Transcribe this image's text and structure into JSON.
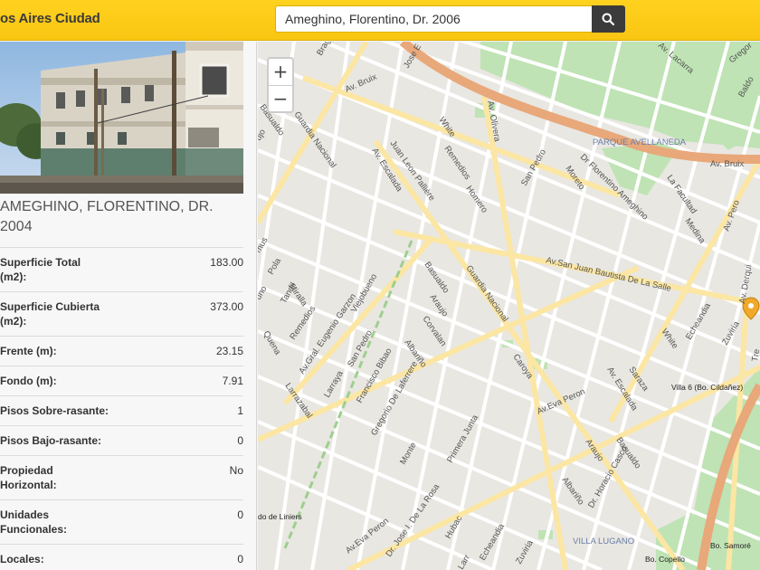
{
  "header": {
    "brand": "os Aires Ciudad",
    "search_value": "Ameghino, Florentino, Dr. 2006"
  },
  "sidebar": {
    "address_line1": "AMEGHINO, FLORENTINO, DR.",
    "address_line2": "2004",
    "attributes": [
      {
        "label": [
          "Superficie Total",
          "(m2):"
        ],
        "value": "183.00"
      },
      {
        "label": [
          "Superficie Cubierta",
          "(m2):"
        ],
        "value": "373.00"
      },
      {
        "label": [
          "Frente (m):"
        ],
        "value": "23.15"
      },
      {
        "label": [
          "Fondo (m):"
        ],
        "value": "7.91"
      },
      {
        "label": [
          "Pisos Sobre-rasante:"
        ],
        "value": "1"
      },
      {
        "label": [
          "Pisos Bajo-rasante:"
        ],
        "value": "0"
      },
      {
        "label": [
          "Propiedad",
          "Horizontal:"
        ],
        "value": "No"
      },
      {
        "label": [
          "Unidades",
          "Funcionales:"
        ],
        "value": "0"
      },
      {
        "label": [
          "Locales:"
        ],
        "value": "0"
      }
    ]
  },
  "map": {
    "zoom_in": "+",
    "zoom_out": "−",
    "labels": {
      "bruix": "Av. Bruix",
      "bruix2": "Av. Bruix",
      "lacarra": "Av. Lacarra",
      "olivera": "Av. Olivera",
      "escalada": "Av. Escalada",
      "escalada2": "Av. Escalada",
      "san_juan": "Av.San Juan Bautista De La Salle",
      "eva_peron": "Av.Eva Peron",
      "eva_peron2": "Av.Eva Peron",
      "garzon": "Av.Gral. Eugenio Garzon",
      "parque": "PARQUE AVELLANEDA",
      "lugano": "VILLA LUGANO",
      "villa6": "Villa 6 (Bo. Cildañez)",
      "copello": "Bo. Copello",
      "samore": "Bo. Samoré",
      "liniers": "do de Liniers",
      "guardia": "Guardia Nacional",
      "guardia2": "Guardia Nacional",
      "pallerie": "Juan Leon Pallière",
      "remedios": "Remedios",
      "remedios2": "Remedios",
      "white": "White",
      "white2": "White",
      "homero": "Homero",
      "san_pedro": "San Pedro",
      "san_pedro2": "San Pedro",
      "moreto": "Moreto",
      "ameghino": "Dr Florentino Ameghino",
      "facultad": "La Facultad",
      "medina": "Medina",
      "basualdo": "Basualdo",
      "basualdo2": "Basualdo",
      "basualdo3": "Basualdo",
      "araujo": "Araujo",
      "araujo2": "Araujo",
      "corvalan": "Corvalan",
      "albarino": "Albariño",
      "albarino2": "Albariño",
      "caroya": "Caroya",
      "miralla": "Miralla",
      "viejobueno": "Viejobueno",
      "tandil": "Tandil",
      "pola": "Pola",
      "larraya": "Larraya",
      "larrazabal": "Larrazabal",
      "bilbao": "Francisco Bibao",
      "laferrere": "Gregorio De Laferrere",
      "monte": "Monte",
      "primera_junta": "Primera Junta",
      "de_la_rosa": "Dr. Jose I. De La Rosa",
      "hubac": "Hubac",
      "echeandia": "Echeandia",
      "echeandia2": "Echeandia",
      "zuviria": "Zuviria",
      "zuviria2": "Zuviria",
      "casco": "Dr. Horacio Casco",
      "saraza": "Saraza",
      "derqui": "Av. Derqui",
      "av_pero": "Av. Pero",
      "quena": "Quena",
      "mus": "mus",
      "uno": "uno",
      "bragado": "Brag",
      "jose_e": "Jose E",
      "bald": "Baldo",
      "gregor": "Gregor",
      "ujo": "ujo",
      "larr": "Larr",
      "tre": "Tre"
    }
  }
}
